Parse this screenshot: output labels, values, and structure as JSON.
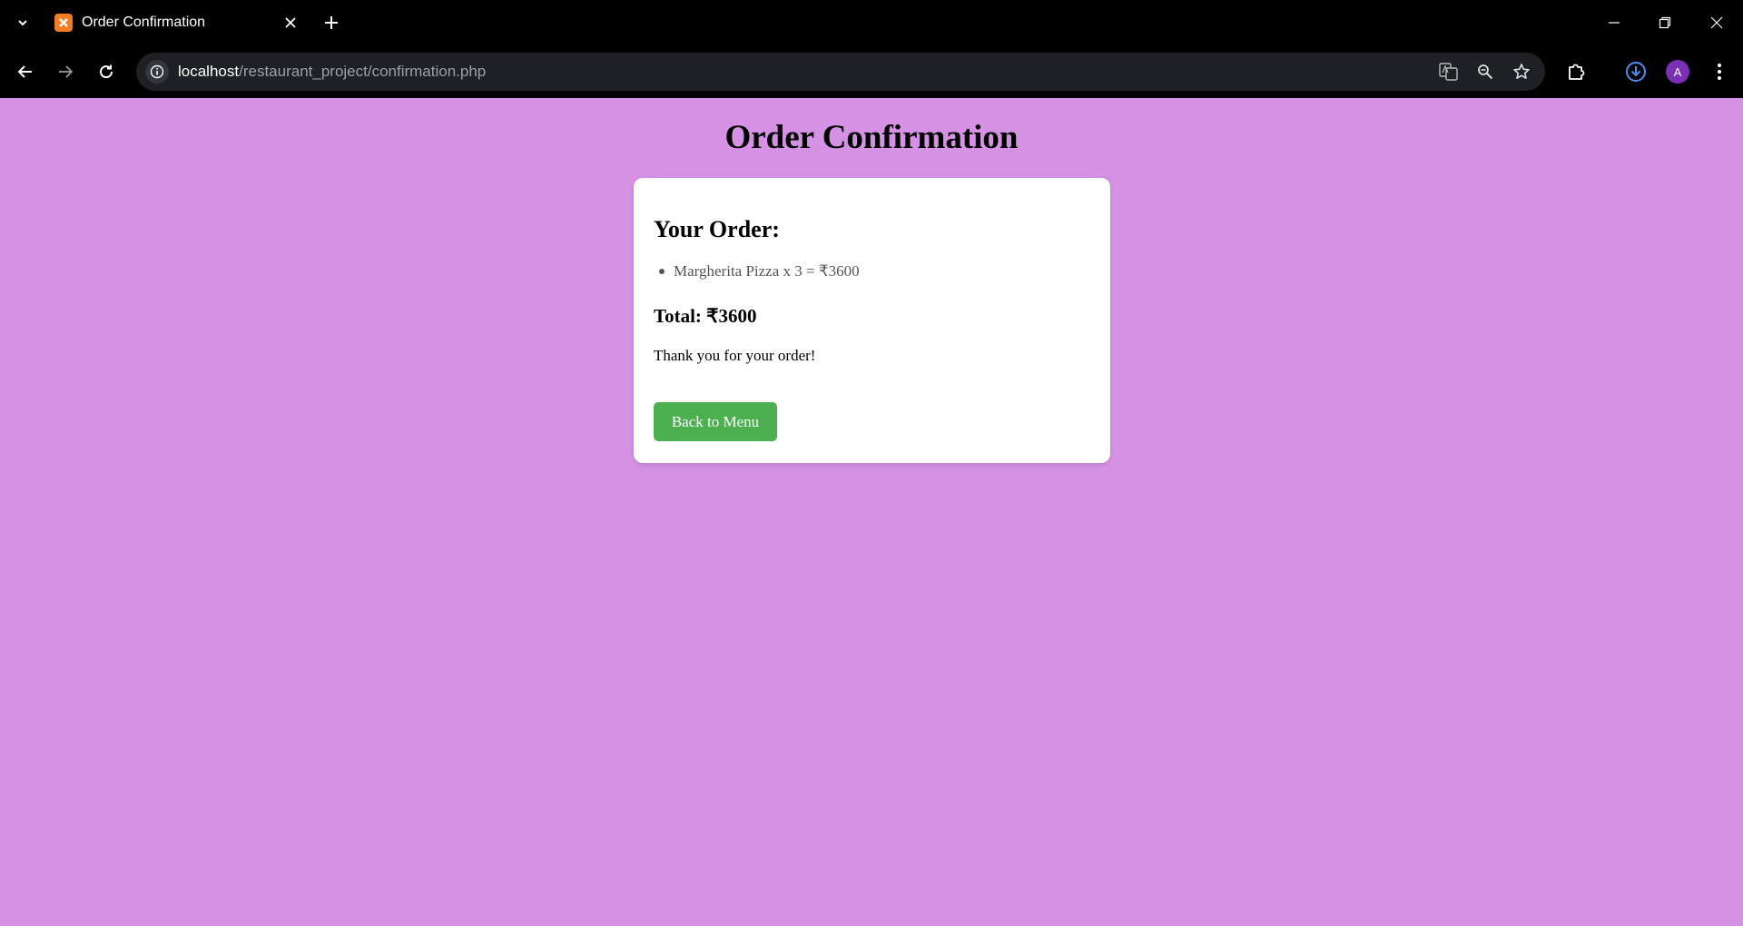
{
  "browser": {
    "tab_title": "Order Confirmation",
    "url_host": "localhost",
    "url_path": "/restaurant_project/confirmation.php",
    "profile_initial": "A",
    "profile_color": "#7b2fb5"
  },
  "page": {
    "title": "Order Confirmation",
    "background": "#d592e5"
  },
  "order": {
    "heading": "Your Order:",
    "items": [
      {
        "text": "Margherita Pizza x 3 = ₹3600"
      }
    ],
    "total": "Total: ₹3600",
    "thanks": "Thank you for your order!",
    "back_button": "Back to Menu",
    "button_color": "#4caf50"
  },
  "icons": {
    "tab_list": "chevron-down-icon",
    "favicon": "xampp-icon",
    "close_tab": "close-icon",
    "new_tab": "plus-icon",
    "back": "arrow-left-icon",
    "forward": "arrow-right-icon",
    "reload": "reload-icon",
    "site_info": "info-icon",
    "translate": "translate-icon",
    "zoom": "zoom-icon",
    "bookmark": "star-icon",
    "extensions": "puzzle-icon",
    "downloads": "download-icon",
    "menu": "kebab-menu-icon"
  }
}
